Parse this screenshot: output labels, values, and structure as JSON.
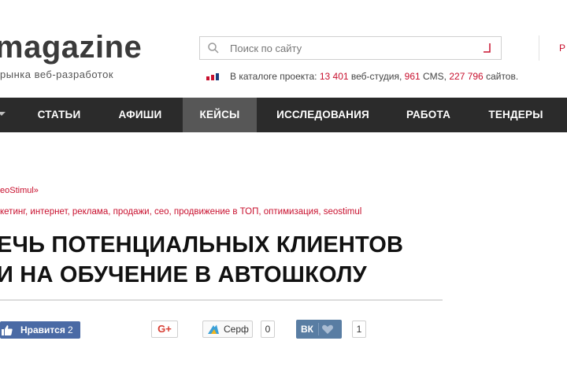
{
  "header": {
    "logo": "magazine",
    "tagline": "рынка веб-разработок",
    "search_placeholder": "Поиск по сайту",
    "red_link": "Р",
    "catalog": {
      "prefix": "В каталоге проекта: ",
      "studios_count": "13 401",
      "studios_label": " веб-студия, ",
      "cms_count": "961",
      "cms_label": " CMS, ",
      "sites_count": "227 796",
      "sites_label": " сайтов."
    }
  },
  "nav": {
    "items": [
      {
        "label": "СТАТЬИ"
      },
      {
        "label": "АФИШИ"
      },
      {
        "label": "КЕЙСЫ",
        "active": true
      },
      {
        "label": "ИССЛЕДОВАНИЯ"
      },
      {
        "label": "РАБОТА"
      },
      {
        "label": "ТЕНДЕРЫ"
      }
    ]
  },
  "article": {
    "breadcrumb": "eoStimul»",
    "tags": "кетинг, интернет, реклама, продажи, сео, продвижение в ТОП, оптимизация, seostimul",
    "title_line1": "ЕЧЬ ПОТЕНЦИАЛЬНЫХ КЛИЕНТОВ",
    "title_line2": "И НА ОБУЧЕНИЕ В АВТОШКОЛУ"
  },
  "social": {
    "fb_label": "Нравится",
    "fb_count": "2",
    "gplus_label": "G+",
    "surf_label": "Серф",
    "surf_count": "0",
    "vk_label": "ВК",
    "vk_count": "1"
  },
  "colors": {
    "accent_red": "#c8102e",
    "nav_bg": "#2b2b2b",
    "nav_active": "#575757",
    "facebook": "#4a6aa5",
    "vk": "#597da3"
  }
}
